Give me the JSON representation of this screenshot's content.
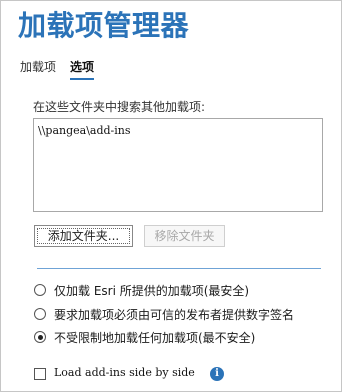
{
  "title": "加载项管理器",
  "tabs": [
    {
      "label": "加载项",
      "selected": false
    },
    {
      "label": "选项",
      "selected": true
    }
  ],
  "folders_section": {
    "label": "在这些文件夹中搜索其他加载项:",
    "folders": [
      "\\\\pangea\\add-ins"
    ]
  },
  "buttons": {
    "add_folder": "添加文件夹...",
    "remove_folder": "移除文件夹"
  },
  "load_options": {
    "options": [
      {
        "label": "仅加载 Esri 所提供的加载项(最安全)",
        "checked": false
      },
      {
        "label": "要求加载项必须由可信的发布者提供数字签名",
        "checked": false
      },
      {
        "label": "不受限制地加载任何加载项(最不安全)",
        "checked": true
      }
    ]
  },
  "side_by_side": {
    "label": "Load add-ins side by side",
    "checked": false,
    "info_icon": "info-icon"
  },
  "colors": {
    "accent": "#2b73b8",
    "divider": "#6fa3d6"
  }
}
